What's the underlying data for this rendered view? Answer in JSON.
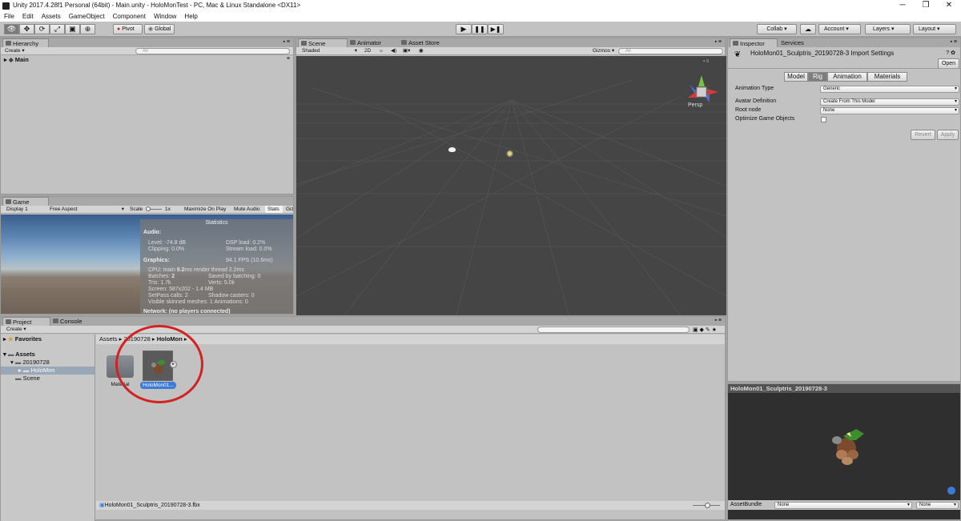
{
  "window": {
    "title": "Unity 2017.4.28f1 Personal (64bit) - Main.unity - HoloMonTest - PC, Mac & Linux Standalone <DX11>",
    "minimize": "─",
    "maximize": "❐",
    "close": "✕"
  },
  "menu": [
    "File",
    "Edit",
    "Assets",
    "GameObject",
    "Component",
    "Window",
    "Help"
  ],
  "toolbar": {
    "pivot": "Pivot",
    "global": "Global",
    "collab": "Collab ▾",
    "account": "Account",
    "layers": "Layers",
    "layout": "Layout"
  },
  "hierarchy": {
    "tab": "Hierarchy",
    "create": "Create ▾",
    "search_placeholder": "All",
    "scene": "Main"
  },
  "scene": {
    "tab": "Scene",
    "tab_animator": "Animator",
    "tab_assetstore": "Asset Store",
    "shading": "Shaded",
    "mode2d": "2D",
    "gizmos": "Gizmos ▾",
    "search_placeholder": "All",
    "persp": "Persp"
  },
  "game": {
    "tab": "Game",
    "display": "Display 1",
    "aspect": "Free Aspect",
    "scale_label": "Scale",
    "scale_value": "1x",
    "max_on_play": "Maximize On Play",
    "mute": "Mute Audio",
    "stats": "Stats",
    "gizmos": "Giz"
  },
  "stats": {
    "title": "Statistics",
    "audio": "Audio:",
    "level": "Level: -74.8 dB",
    "clipping": "Clipping: 0.0%",
    "dsp": "DSP load: 0.2%",
    "stream": "Stream load: 0.0%",
    "graphics": "Graphics:",
    "fps": "94.1 FPS (10.6ms)",
    "cpu_pre": "CPU: main ",
    "cpu_main": "9.2",
    "cpu_post": "ms  render thread 2.2ms",
    "batches_pre": "Batches: ",
    "batches": "2",
    "saved": "Saved by batching: 0",
    "tris": "Tris: 1.7k",
    "verts": "Verts: 5.0k",
    "screen": "Screen: 587x202 - 1.4 MB",
    "setpass": "SetPass calls: 2",
    "shadow": "Shadow casters: 0",
    "skinned": "Visible skinned meshes: 1  Animations: 0",
    "network": "Network: (no players connected)"
  },
  "project": {
    "tab": "Project",
    "tab_console": "Console",
    "create": "Create ▾",
    "favorites": "Favorites",
    "assets": "Assets",
    "folder_date": "20190728",
    "folder_holomon": "HoloMon",
    "folder_scene": "Scene",
    "breadcrumb": [
      "Assets",
      "20190728",
      "HoloMon"
    ],
    "items": [
      {
        "label": "Material"
      },
      {
        "label": "HoloMon01..."
      }
    ],
    "footer": "HoloMon01_Sculptris_20190728-3.fbx"
  },
  "inspector": {
    "tab": "Inspector",
    "tab_services": "Services",
    "title": "HoloMon01_Sculptris_20190728-3 Import Settings",
    "open": "Open",
    "tabs": [
      "Model",
      "Rig",
      "Animation",
      "Materials"
    ],
    "active_tab": 1,
    "fields": [
      {
        "label": "Animation Type",
        "value": "Generic"
      },
      {
        "label": "Avatar Definition",
        "value": "Create From This Model"
      },
      {
        "label": "Root node",
        "value": "None"
      },
      {
        "label": "Optimize Game Objects",
        "value": ""
      }
    ],
    "revert": "Revert",
    "apply": "Apply"
  },
  "preview": {
    "title": "HoloMon01_Sculptris_20190728-3",
    "assetbundle": "AssetBundle",
    "bundle_value": "None",
    "variant_value": "None"
  },
  "colors": {
    "annotation": "#d42121",
    "selection": "#3e7bd6",
    "scene_bg": "#454545",
    "panel": "#c2c2c2"
  }
}
